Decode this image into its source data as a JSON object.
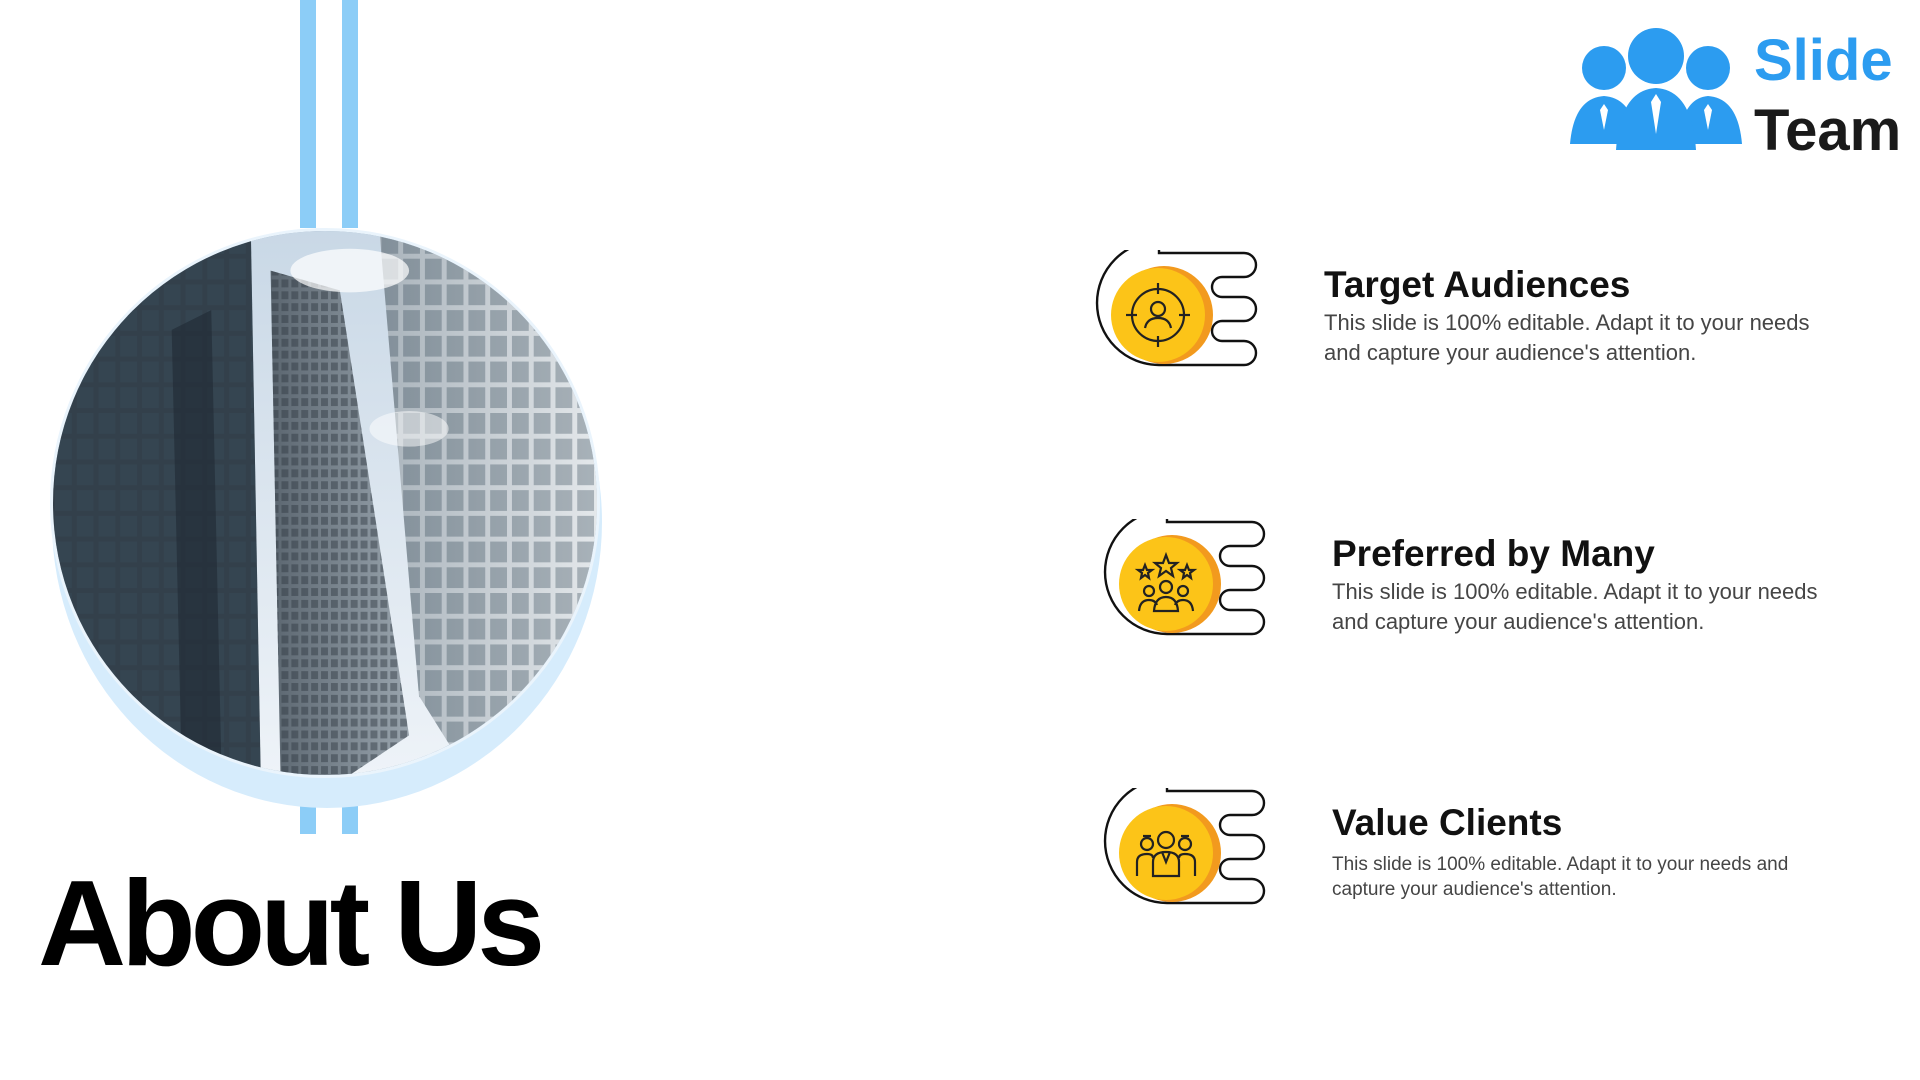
{
  "logo": {
    "line1": "Slide",
    "line2": "Team",
    "icon": "people-group-icon"
  },
  "title": "About Us",
  "image": {
    "subject": "skyscrapers-photo"
  },
  "colors": {
    "accent_blue": "#8ccdf7",
    "badge_yellow": "#fcc418",
    "badge_orange": "#f29a1e",
    "logo_blue": "#2c9cf0"
  },
  "items": [
    {
      "title": "Target Audiences",
      "description": "This slide is 100% editable. Adapt it to your needs and capture your audience's attention.",
      "icon": "target-person-icon"
    },
    {
      "title": "Preferred by Many",
      "description": "This slide is 100% editable. Adapt it to your needs and capture your audience's attention.",
      "icon": "group-stars-icon"
    },
    {
      "title": "Value Clients",
      "description": "This slide is 100% editable. Adapt it to your needs and capture your audience's attention.",
      "icon": "clients-group-icon"
    }
  ]
}
